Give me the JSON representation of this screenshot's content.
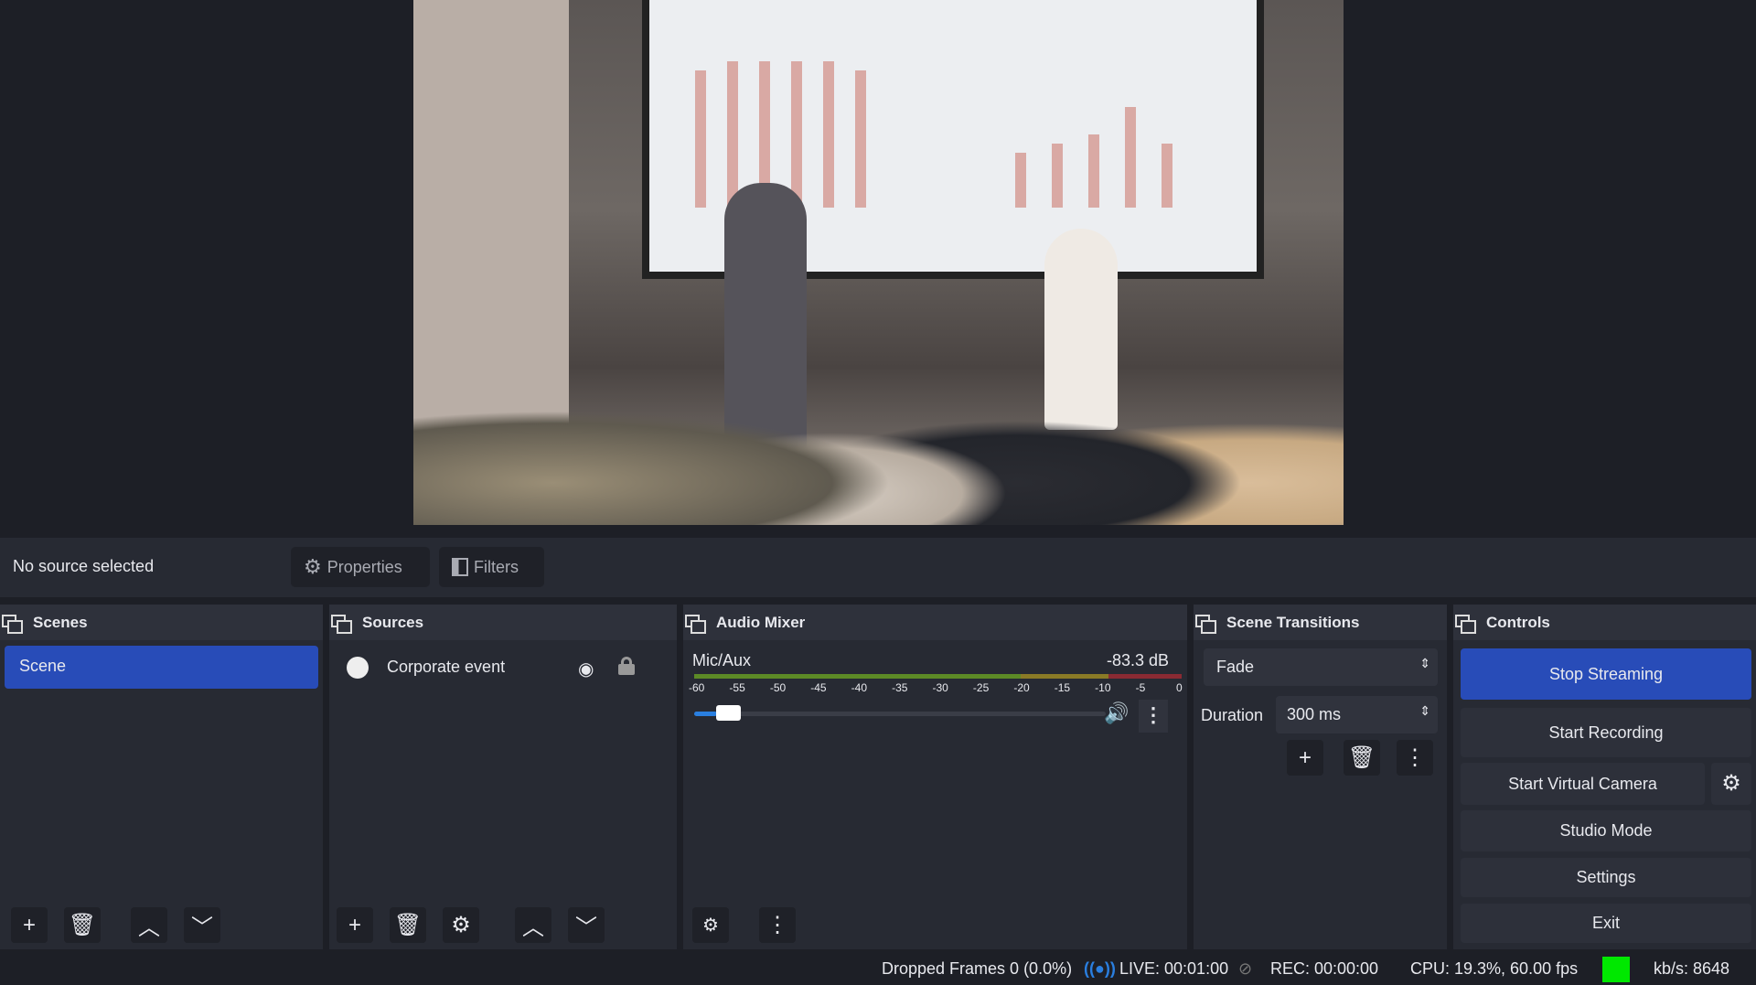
{
  "preview": {
    "description_alt": "Corporate event"
  },
  "source_bar": {
    "label": "No source selected",
    "properties": "Properties",
    "filters": "Filters"
  },
  "scenes": {
    "title": "Scenes",
    "items": [
      "Scene"
    ]
  },
  "sources": {
    "title": "Sources",
    "items": [
      "Corporate event"
    ]
  },
  "audio_mixer": {
    "title": "Audio Mixer",
    "channel": "Mic/Aux",
    "level": "-83.3 dB",
    "ticks": [
      "-60",
      "-55",
      "-50",
      "-45",
      "-40",
      "-35",
      "-30",
      "-25",
      "-20",
      "-15",
      "-10",
      "-5",
      "0"
    ],
    "volume_fraction": 0.06
  },
  "transitions": {
    "title": "Scene Transitions",
    "selected": "Fade",
    "duration_label": "Duration",
    "duration": "300 ms"
  },
  "controls": {
    "title": "Controls",
    "stop_streaming": "Stop Streaming",
    "start_recording": "Start Recording",
    "start_virtual_camera": "Start Virtual Camera",
    "studio_mode": "Studio Mode",
    "settings": "Settings",
    "exit": "Exit"
  },
  "status": {
    "dropped": "Dropped Frames 0 (0.0%)",
    "live": "LIVE: 00:01:00",
    "rec": "REC: 00:00:00",
    "cpu": "CPU: 19.3%, 60.00 fps",
    "kbs": "kb/s: 8648"
  },
  "colors": {
    "accent": "#284cb8",
    "health": "#00e800",
    "live_icon": "#2a7fe0"
  }
}
